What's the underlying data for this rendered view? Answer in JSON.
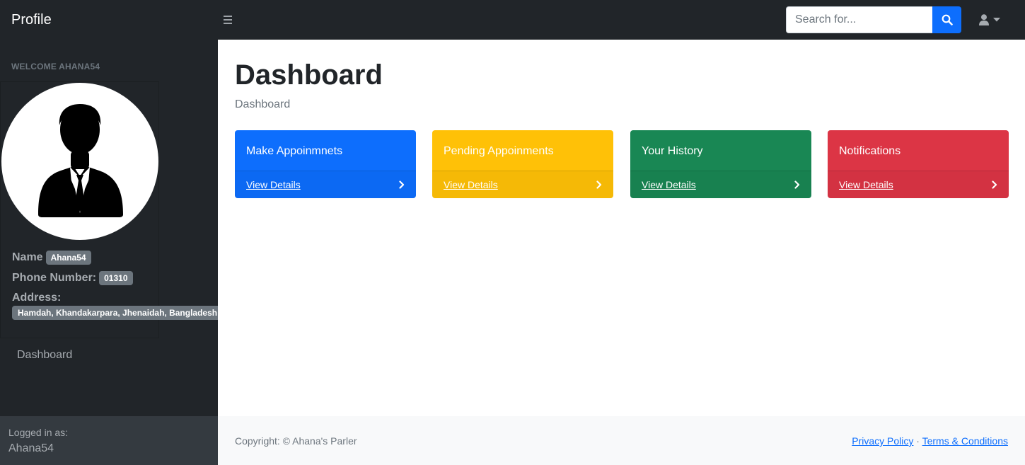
{
  "navbar": {
    "brand": "Profile",
    "search_placeholder": "Search for..."
  },
  "sidebar": {
    "welcome": "WELCOME AHANA54",
    "profile": {
      "name_label": "Name",
      "name_value": "Ahana54",
      "phone_label": "Phone Number:",
      "phone_value": "01310",
      "address_label": "Address:",
      "address_value": "Hamdah, Khandakarpara, Jhenaidah, Bangladesh"
    },
    "nav_items": [
      {
        "label": "Dashboard"
      }
    ],
    "footer": {
      "logged_label": "Logged in as:",
      "logged_user": "Ahana54"
    }
  },
  "main": {
    "title": "Dashboard",
    "breadcrumb": "Dashboard",
    "cards": [
      {
        "title": "Make Appoinmnets",
        "link": "View Details",
        "color": "#0d6efd"
      },
      {
        "title": "Pending Appoinments",
        "link": "View Details",
        "color": "#ffc107"
      },
      {
        "title": "Your History",
        "link": "View Details",
        "color": "#198754"
      },
      {
        "title": "Notifications",
        "link": "View Details",
        "color": "#dc3545"
      }
    ]
  },
  "footer": {
    "copyright": "Copyright: © Ahana's Parler",
    "privacy": "Privacy Policy",
    "separator": "·",
    "terms": "Terms & Conditions"
  },
  "icons": {
    "menu": "hamburger-icon",
    "search": "search-icon",
    "user": "user-icon",
    "caret": "caret-down-icon",
    "chevron": "chevron-right-icon"
  }
}
